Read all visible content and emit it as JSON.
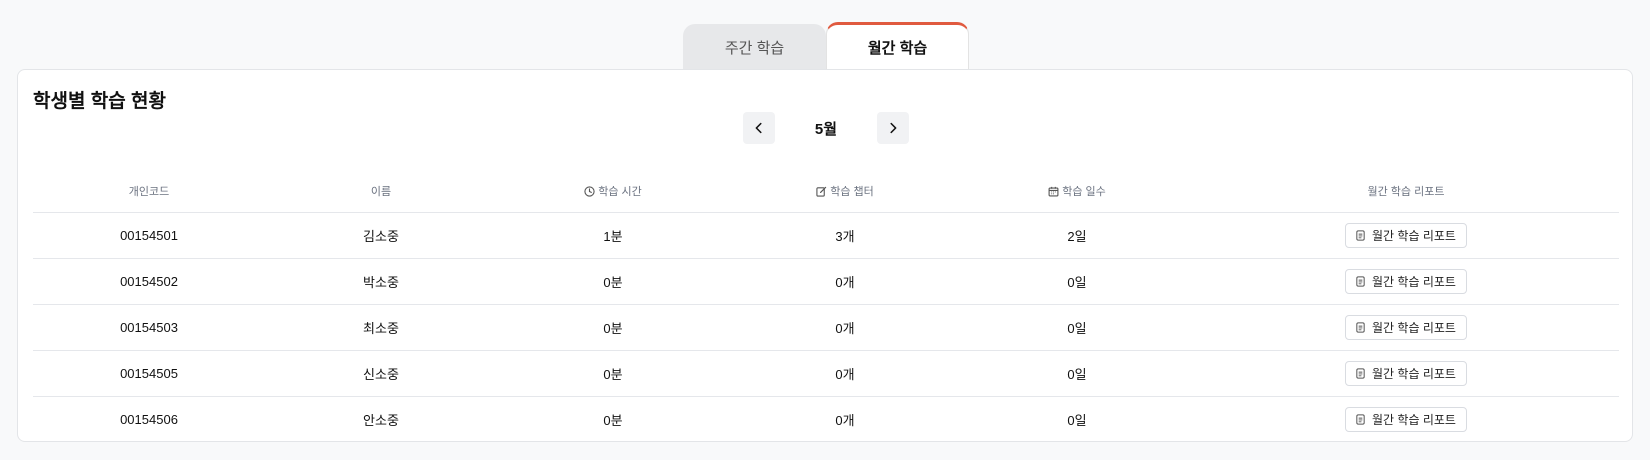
{
  "tabs": [
    {
      "label": "주간 학습",
      "active": false
    },
    {
      "label": "월간 학습",
      "active": true
    }
  ],
  "card": {
    "title": "학생별 학습 현황",
    "month": "5월",
    "prev_icon": "chevron-left-icon",
    "next_icon": "chevron-right-icon"
  },
  "table": {
    "headers": {
      "code": "개인코드",
      "name": "이름",
      "time": "학습 시간",
      "chapter": "학습 챕터",
      "days": "학습 일수",
      "report": "월간 학습 리포트"
    },
    "rows": [
      {
        "code": "00154501",
        "name": "김소중",
        "time": "1분",
        "chapter": "3개",
        "days": "2일",
        "report": "월간 학습 리포트"
      },
      {
        "code": "00154502",
        "name": "박소중",
        "time": "0분",
        "chapter": "0개",
        "days": "0일",
        "report": "월간 학습 리포트"
      },
      {
        "code": "00154503",
        "name": "최소중",
        "time": "0분",
        "chapter": "0개",
        "days": "0일",
        "report": "월간 학습 리포트"
      },
      {
        "code": "00154505",
        "name": "신소중",
        "time": "0분",
        "chapter": "0개",
        "days": "0일",
        "report": "월간 학습 리포트"
      },
      {
        "code": "00154506",
        "name": "안소중",
        "time": "0분",
        "chapter": "0개",
        "days": "0일",
        "report": "월간 학습 리포트"
      }
    ]
  },
  "colors": {
    "accent": "#e05a3f",
    "background": "#f8f9fa"
  }
}
